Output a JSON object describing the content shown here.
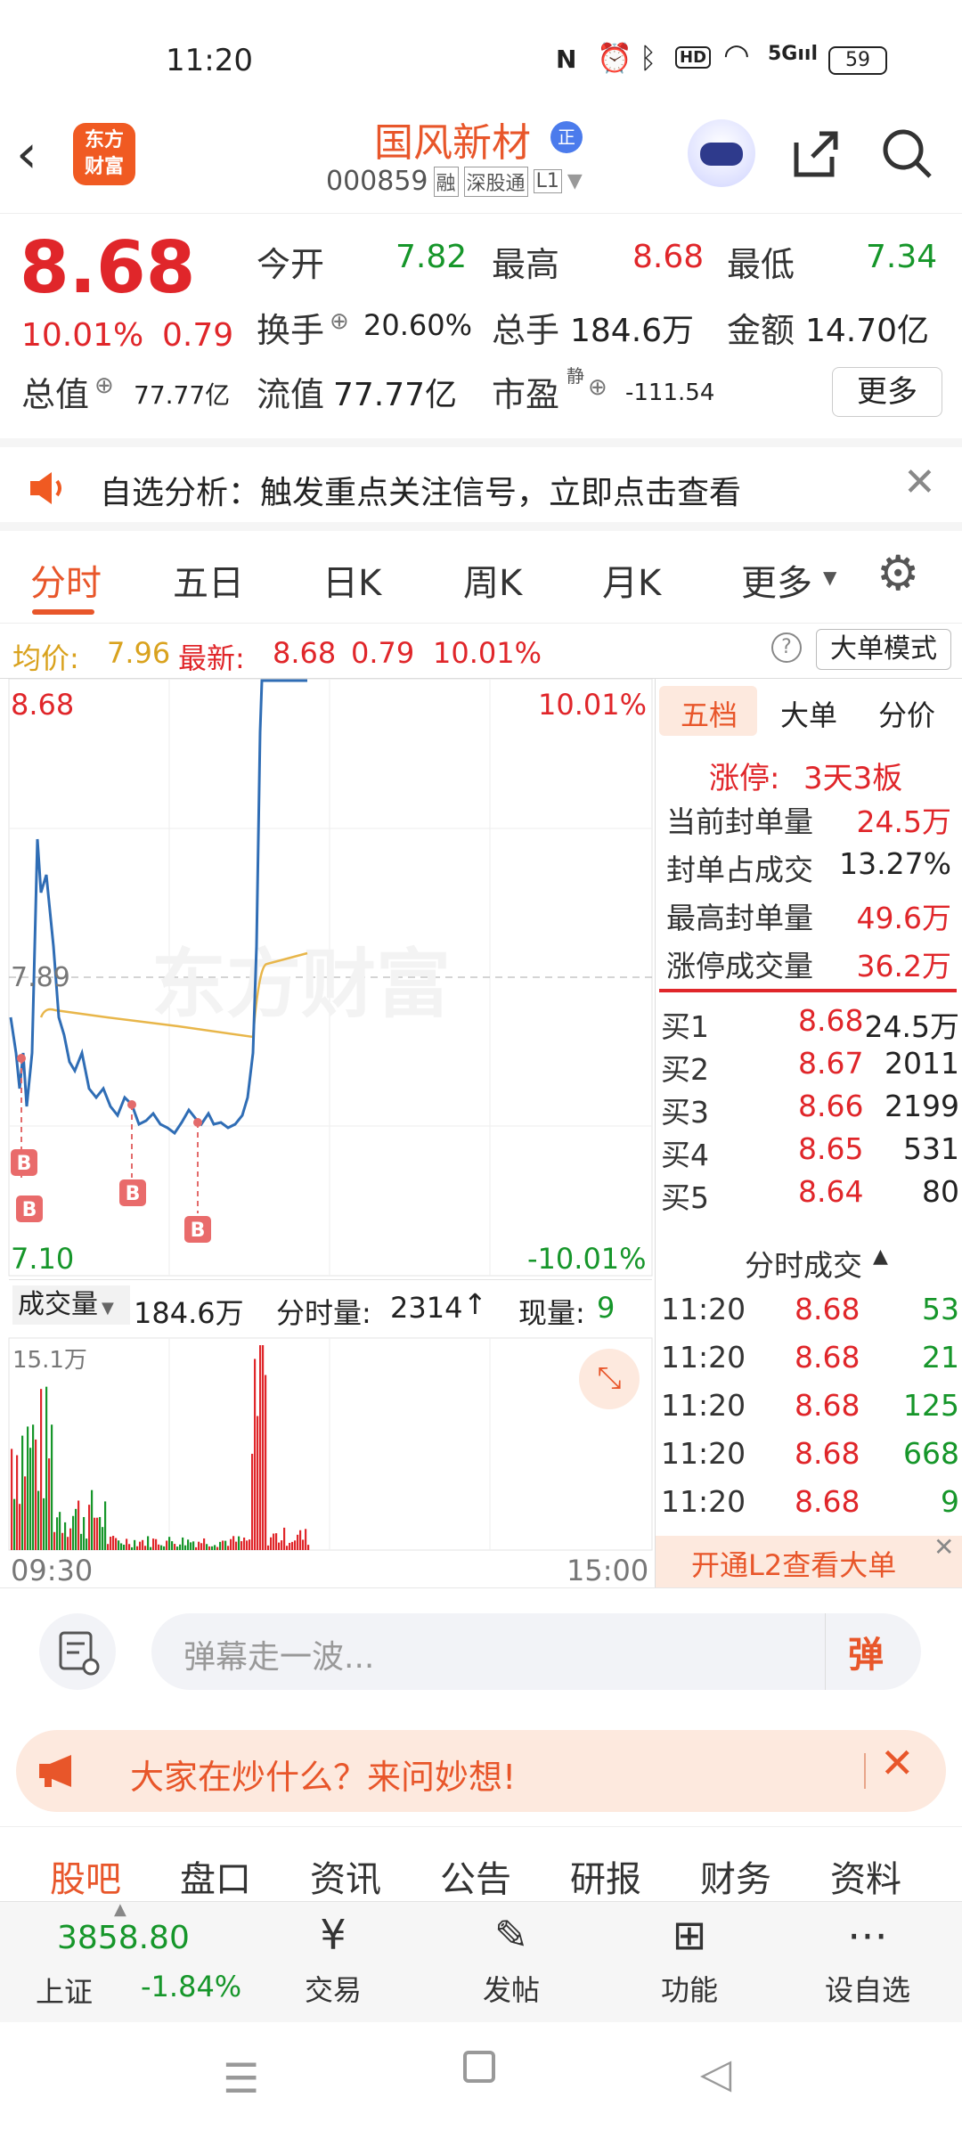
{
  "status": {
    "time": "11:20",
    "battery": "59"
  },
  "header": {
    "logo_text": "东方财富",
    "stock_name": "国风新材",
    "badge": "正",
    "code": "000859",
    "tags": [
      "融",
      "深股通",
      "L1"
    ]
  },
  "quote": {
    "price": "8.68",
    "change_pct": "10.01%",
    "change": "0.79",
    "open_label": "今开",
    "open": "7.82",
    "high_label": "最高",
    "high": "8.68",
    "low_label": "最低",
    "low": "7.34",
    "turnover_label": "换手",
    "turnover": "20.60%",
    "volume_label": "总手",
    "volume": "184.6万",
    "amount_label": "金额",
    "amount": "14.70亿",
    "mktcap_label": "总值",
    "mktcap": "77.77亿",
    "float_label": "流值",
    "float": "77.77亿",
    "pe_label": "市盈",
    "pe_sup": "静",
    "pe": "-111.54",
    "more_button": "更多"
  },
  "notice": {
    "text": "自选分析：触发重点关注信号，立即点击查看"
  },
  "tabs": [
    "分时",
    "五日",
    "日K",
    "周K",
    "月K",
    "更多"
  ],
  "avgbar": {
    "avg_label": "均价:",
    "avg": "7.96",
    "latest_label": "最新:",
    "latest": "8.68",
    "chg": "0.79",
    "pct": "10.01%",
    "mode_button": "大单模式"
  },
  "chart": {
    "price_top": "8.68",
    "pct_top": "10.01%",
    "mid": "7.89",
    "price_bottom": "7.10",
    "pct_bottom": "-10.01%",
    "watermark": "东方财富",
    "vol_label": "成交量",
    "vol_total": "184.6万",
    "time_vol_label": "分时量:",
    "time_vol": "2314",
    "cur_vol_label": "现量:",
    "cur_vol": "9",
    "vol_max": "15.1万",
    "time_start": "09:30",
    "time_end": "15:00",
    "marker": "B"
  },
  "side": {
    "tabs": [
      "五档",
      "大单",
      "分价"
    ],
    "limit_up_label": "涨停:",
    "limit_up": "3天3板",
    "stats": [
      {
        "label": "当前封单量",
        "value": "24.5万",
        "color": "#e0262a"
      },
      {
        "label": "封单占成交",
        "value": "13.27%",
        "color": "#222"
      },
      {
        "label": "最高封单量",
        "value": "49.6万",
        "color": "#e0262a"
      },
      {
        "label": "涨停成交量",
        "value": "36.2万",
        "color": "#e0262a"
      }
    ],
    "bids": [
      {
        "label": "买1",
        "price": "8.68",
        "vol": "24.5万"
      },
      {
        "label": "买2",
        "price": "8.67",
        "vol": "2011"
      },
      {
        "label": "买3",
        "price": "8.66",
        "vol": "2199"
      },
      {
        "label": "买4",
        "price": "8.65",
        "vol": "531"
      },
      {
        "label": "买5",
        "price": "8.64",
        "vol": "80"
      }
    ],
    "trades_title": "分时成交",
    "trades": [
      {
        "time": "11:20",
        "price": "8.68",
        "vol": "53"
      },
      {
        "time": "11:20",
        "price": "8.68",
        "vol": "21"
      },
      {
        "time": "11:20",
        "price": "8.68",
        "vol": "125"
      },
      {
        "time": "11:20",
        "price": "8.68",
        "vol": "668"
      },
      {
        "time": "11:20",
        "price": "8.68",
        "vol": "9"
      }
    ],
    "l2_banner": "开通L2查看大单"
  },
  "danmu": {
    "placeholder": "弹幕走一波...",
    "send": "弹"
  },
  "ask": {
    "text": "大家在炒什么？来问妙想!"
  },
  "subtabs": [
    "股吧",
    "盘口",
    "资讯",
    "公告",
    "研报",
    "财务",
    "资料"
  ],
  "bottom": {
    "index_value": "3858.80",
    "index_name": "上证",
    "index_pct": "-1.84%",
    "items": [
      "交易",
      "发帖",
      "功能",
      "设自选"
    ]
  }
}
